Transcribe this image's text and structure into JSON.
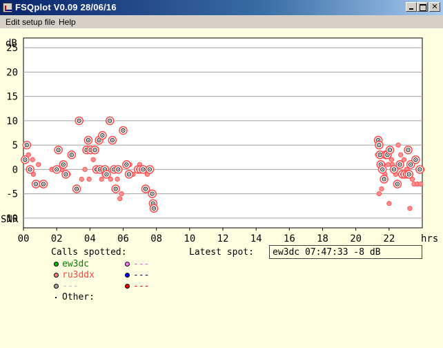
{
  "window": {
    "title": "FSQplot V0.09 28/06/16"
  },
  "menu": {
    "items": [
      "Edit setup file",
      "Help"
    ]
  },
  "chart_data": {
    "type": "scatter",
    "yunit_top": "dB",
    "ylabel": "SNR",
    "xlabel": "hrs",
    "xlim": [
      0,
      24
    ],
    "ylim": [
      -12,
      27
    ],
    "yticks": [
      25,
      20,
      15,
      10,
      5,
      0,
      -5,
      -10
    ],
    "ytick_labels": [
      "25",
      "20",
      "15",
      "10",
      "5",
      "0",
      "-5",
      "-10"
    ],
    "xticks": [
      0,
      2,
      4,
      6,
      8,
      10,
      12,
      14,
      16,
      18,
      20,
      22
    ],
    "xtick_labels": [
      "00",
      "02",
      "04",
      "06",
      "08",
      "10",
      "12",
      "14",
      "16",
      "18",
      "20",
      "22"
    ],
    "grid": "horizontal",
    "series": [
      {
        "name": "ew3dc",
        "color": "#008000",
        "points": [
          [
            0.1,
            2
          ],
          [
            0.2,
            5
          ],
          [
            0.4,
            0
          ],
          [
            0.75,
            -3
          ],
          [
            1.2,
            -3
          ],
          [
            2.0,
            0
          ],
          [
            2.1,
            4
          ],
          [
            2.4,
            1
          ],
          [
            2.55,
            -1
          ],
          [
            2.9,
            3
          ],
          [
            3.2,
            -4
          ],
          [
            3.35,
            10
          ],
          [
            3.8,
            4
          ],
          [
            3.9,
            6
          ],
          [
            4.05,
            4
          ],
          [
            4.3,
            4
          ],
          [
            4.4,
            0
          ],
          [
            4.55,
            6
          ],
          [
            4.6,
            0
          ],
          [
            4.75,
            7
          ],
          [
            4.9,
            0
          ],
          [
            5.0,
            -1
          ],
          [
            5.2,
            10
          ],
          [
            5.35,
            6
          ],
          [
            5.45,
            0
          ],
          [
            5.55,
            -4
          ],
          [
            5.7,
            0
          ],
          [
            6.0,
            8
          ],
          [
            6.2,
            1
          ],
          [
            6.35,
            -1
          ],
          [
            6.9,
            0
          ],
          [
            7.05,
            0
          ],
          [
            7.2,
            0
          ],
          [
            7.35,
            -4
          ],
          [
            7.6,
            0
          ],
          [
            7.75,
            -5
          ],
          [
            7.8,
            -7
          ],
          [
            7.85,
            -8
          ],
          [
            21.35,
            6
          ],
          [
            21.4,
            5
          ],
          [
            21.45,
            3
          ],
          [
            21.5,
            1
          ],
          [
            21.6,
            0
          ],
          [
            21.7,
            -2
          ],
          [
            21.8,
            3
          ],
          [
            21.9,
            3
          ],
          [
            22.05,
            4
          ],
          [
            22.3,
            0
          ],
          [
            22.5,
            -3
          ],
          [
            22.65,
            1
          ],
          [
            22.8,
            -1
          ],
          [
            22.95,
            -1
          ],
          [
            23.1,
            -1
          ],
          [
            23.15,
            4
          ],
          [
            23.2,
            -1
          ],
          [
            23.3,
            1
          ],
          [
            23.6,
            2
          ],
          [
            23.85,
            0
          ]
        ]
      },
      {
        "name": "ru3ddx",
        "color": "#ff4040",
        "points": [
          [
            0.0,
            2
          ],
          [
            0.3,
            3
          ],
          [
            0.55,
            2
          ],
          [
            0.6,
            -1
          ],
          [
            0.9,
            1
          ],
          [
            1.05,
            -3
          ],
          [
            1.7,
            0
          ],
          [
            2.3,
            0
          ],
          [
            2.7,
            -1
          ],
          [
            3.5,
            -2
          ],
          [
            3.7,
            0
          ],
          [
            3.95,
            -2
          ],
          [
            4.2,
            2
          ],
          [
            4.7,
            -2
          ],
          [
            4.85,
            -1
          ],
          [
            5.1,
            -1
          ],
          [
            5.25,
            -2
          ],
          [
            5.65,
            -2
          ],
          [
            5.8,
            -6
          ],
          [
            5.9,
            -5
          ],
          [
            6.4,
            1
          ],
          [
            6.6,
            -1
          ],
          [
            7.0,
            1
          ],
          [
            7.45,
            -1
          ],
          [
            21.3,
            3
          ],
          [
            21.4,
            -5
          ],
          [
            21.55,
            -4
          ],
          [
            21.65,
            1
          ],
          [
            21.75,
            -1
          ],
          [
            21.95,
            1
          ],
          [
            22.0,
            -7
          ],
          [
            22.15,
            2
          ],
          [
            22.2,
            1
          ],
          [
            22.4,
            -1
          ],
          [
            22.55,
            5
          ],
          [
            22.7,
            3
          ],
          [
            22.9,
            2
          ],
          [
            23.05,
            0
          ],
          [
            23.25,
            -8
          ],
          [
            23.4,
            -2
          ],
          [
            23.5,
            -3
          ],
          [
            23.7,
            -3
          ],
          [
            23.9,
            -3
          ],
          [
            24.0,
            0
          ]
        ]
      }
    ]
  },
  "calls": {
    "heading": "Calls spotted:",
    "entries": [
      {
        "label": "ew3dc",
        "color": "#008000",
        "marker": "#00c000"
      },
      {
        "label": "ru3ddx",
        "color": "#ff4040",
        "marker": "#ff8080"
      },
      {
        "label": "---",
        "color": "#b0b0b0",
        "marker": "#a0a0a0"
      },
      {
        "label": "---",
        "color": "#ff40ff",
        "marker": "#ff80ff"
      },
      {
        "label": "---",
        "color": "#000080",
        "marker": "#0000ff"
      },
      {
        "label": "---",
        "color": "#ff0000",
        "marker": "#ff0000"
      }
    ],
    "other_label": "Other:"
  },
  "latest": {
    "label": "Latest spot:",
    "value": "ew3dc 07:47:33 -8 dB"
  }
}
